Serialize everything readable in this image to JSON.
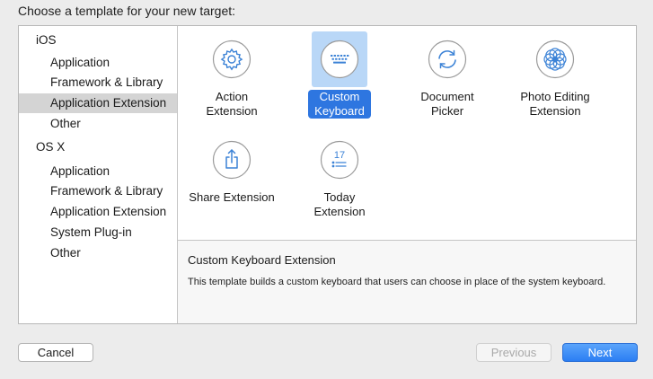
{
  "dialog": {
    "title": "Choose a template for your new target:"
  },
  "sidebar": {
    "ios_label": "iOS",
    "ios_items": [
      "Application",
      "Framework & Library",
      "Application Extension",
      "Other"
    ],
    "osx_label": "OS X",
    "osx_items": [
      "Application",
      "Framework & Library",
      "Application Extension",
      "System Plug-in",
      "Other"
    ],
    "selected": "iOS / Application Extension"
  },
  "templates": [
    {
      "label": "Action\nExtension",
      "icon": "gear-icon"
    },
    {
      "label": "Custom\nKeyboard",
      "icon": "keyboard-icon",
      "selected": true
    },
    {
      "label": "Document\nPicker",
      "icon": "sync-arrows-icon"
    },
    {
      "label": "Photo Editing\nExtension",
      "icon": "flower-icon"
    },
    {
      "label": "Share Extension",
      "icon": "share-icon"
    },
    {
      "label": "Today\nExtension",
      "icon": "calendar-list-icon",
      "icon_text": "17"
    }
  ],
  "description": {
    "title": "Custom Keyboard Extension",
    "body": "This template builds a custom keyboard that users can choose in place of the system keyboard."
  },
  "buttons": {
    "cancel": "Cancel",
    "previous": "Previous",
    "next": "Next"
  },
  "colors": {
    "accent": "#2e76e0",
    "selection_tile": "#b9d7f7",
    "icon_stroke": "#3b82d6"
  }
}
